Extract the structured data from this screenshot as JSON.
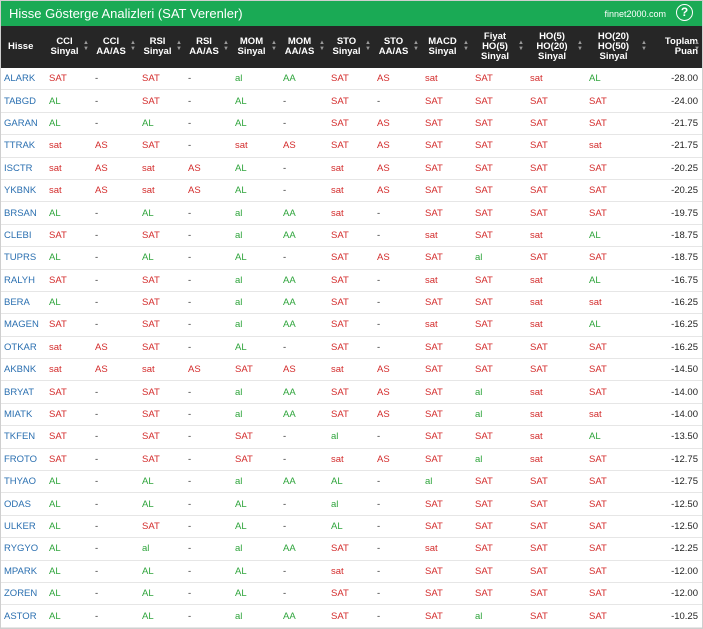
{
  "header": {
    "title": "Hisse Gösterge Analizleri (SAT Verenler)",
    "brand": "finnet2000.com",
    "help_label": "?"
  },
  "colors": {
    "header_bg": "#1aaa55",
    "table_header_bg": "#262626",
    "sat": "#d32b2b",
    "al": "#2ea43b",
    "symbol": "#2a6fb0"
  },
  "columns": [
    [
      "Hisse"
    ],
    [
      "CCI",
      "Sinyal"
    ],
    [
      "CCI",
      "AA/AS"
    ],
    [
      "RSI",
      "Sinyal"
    ],
    [
      "RSI",
      "AA/AS"
    ],
    [
      "MOM",
      "Sinyal"
    ],
    [
      "MOM",
      "AA/AS"
    ],
    [
      "STO",
      "Sinyal"
    ],
    [
      "STO",
      "AA/AS"
    ],
    [
      "MACD",
      "Sinyal"
    ],
    [
      "Fiyat",
      "HO(5)",
      "Sinyal"
    ],
    [
      "HO(5)",
      "HO(20)",
      "Sinyal"
    ],
    [
      "HO(20)",
      "HO(50)",
      "Sinyal"
    ],
    [
      "Toplam",
      "Puan"
    ]
  ],
  "rows": [
    [
      "ALARK",
      "SAT",
      "-",
      "SAT",
      "-",
      "al",
      "AA",
      "SAT",
      "AS",
      "sat",
      "SAT",
      "sat",
      "AL",
      "-28.00"
    ],
    [
      "TABGD",
      "AL",
      "-",
      "SAT",
      "-",
      "AL",
      "-",
      "SAT",
      "-",
      "SAT",
      "SAT",
      "SAT",
      "SAT",
      "-24.00"
    ],
    [
      "GARAN",
      "AL",
      "-",
      "AL",
      "-",
      "AL",
      "-",
      "SAT",
      "AS",
      "SAT",
      "SAT",
      "SAT",
      "SAT",
      "-21.75"
    ],
    [
      "TTRAK",
      "sat",
      "AS",
      "SAT",
      "-",
      "sat",
      "AS",
      "SAT",
      "AS",
      "SAT",
      "SAT",
      "SAT",
      "sat",
      "-21.75"
    ],
    [
      "ISCTR",
      "sat",
      "AS",
      "sat",
      "AS",
      "AL",
      "-",
      "sat",
      "AS",
      "SAT",
      "SAT",
      "SAT",
      "SAT",
      "-20.25"
    ],
    [
      "YKBNK",
      "sat",
      "AS",
      "sat",
      "AS",
      "AL",
      "-",
      "sat",
      "AS",
      "SAT",
      "SAT",
      "SAT",
      "SAT",
      "-20.25"
    ],
    [
      "BRSAN",
      "AL",
      "-",
      "AL",
      "-",
      "al",
      "AA",
      "sat",
      "-",
      "SAT",
      "SAT",
      "SAT",
      "SAT",
      "-19.75"
    ],
    [
      "CLEBI",
      "SAT",
      "-",
      "SAT",
      "-",
      "al",
      "AA",
      "SAT",
      "-",
      "sat",
      "SAT",
      "sat",
      "AL",
      "-18.75"
    ],
    [
      "TUPRS",
      "AL",
      "-",
      "AL",
      "-",
      "AL",
      "-",
      "SAT",
      "AS",
      "SAT",
      "al",
      "SAT",
      "SAT",
      "-18.75"
    ],
    [
      "RALYH",
      "SAT",
      "-",
      "SAT",
      "-",
      "al",
      "AA",
      "SAT",
      "-",
      "sat",
      "SAT",
      "sat",
      "AL",
      "-16.75"
    ],
    [
      "BERA",
      "AL",
      "-",
      "SAT",
      "-",
      "al",
      "AA",
      "SAT",
      "-",
      "SAT",
      "SAT",
      "sat",
      "sat",
      "-16.25"
    ],
    [
      "MAGEN",
      "SAT",
      "-",
      "SAT",
      "-",
      "al",
      "AA",
      "SAT",
      "-",
      "sat",
      "SAT",
      "sat",
      "AL",
      "-16.25"
    ],
    [
      "OTKAR",
      "sat",
      "AS",
      "SAT",
      "-",
      "AL",
      "-",
      "SAT",
      "-",
      "SAT",
      "SAT",
      "SAT",
      "SAT",
      "-16.25"
    ],
    [
      "AKBNK",
      "sat",
      "AS",
      "sat",
      "AS",
      "SAT",
      "AS",
      "sat",
      "AS",
      "SAT",
      "SAT",
      "SAT",
      "SAT",
      "-14.50"
    ],
    [
      "BRYAT",
      "SAT",
      "-",
      "SAT",
      "-",
      "al",
      "AA",
      "SAT",
      "AS",
      "SAT",
      "al",
      "sat",
      "SAT",
      "-14.00"
    ],
    [
      "MIATK",
      "SAT",
      "-",
      "SAT",
      "-",
      "al",
      "AA",
      "SAT",
      "AS",
      "SAT",
      "al",
      "sat",
      "sat",
      "-14.00"
    ],
    [
      "TKFEN",
      "SAT",
      "-",
      "SAT",
      "-",
      "SAT",
      "-",
      "al",
      "-",
      "SAT",
      "SAT",
      "sat",
      "AL",
      "-13.50"
    ],
    [
      "FROTO",
      "SAT",
      "-",
      "SAT",
      "-",
      "SAT",
      "-",
      "sat",
      "AS",
      "SAT",
      "al",
      "sat",
      "SAT",
      "-12.75"
    ],
    [
      "THYAO",
      "AL",
      "-",
      "AL",
      "-",
      "al",
      "AA",
      "AL",
      "-",
      "al",
      "SAT",
      "SAT",
      "SAT",
      "-12.75"
    ],
    [
      "ODAS",
      "AL",
      "-",
      "AL",
      "-",
      "AL",
      "-",
      "al",
      "-",
      "SAT",
      "SAT",
      "SAT",
      "SAT",
      "-12.50"
    ],
    [
      "ULKER",
      "AL",
      "-",
      "SAT",
      "-",
      "AL",
      "-",
      "AL",
      "-",
      "SAT",
      "SAT",
      "SAT",
      "SAT",
      "-12.50"
    ],
    [
      "RYGYO",
      "AL",
      "-",
      "al",
      "-",
      "al",
      "AA",
      "SAT",
      "-",
      "sat",
      "SAT",
      "SAT",
      "SAT",
      "-12.25"
    ],
    [
      "MPARK",
      "AL",
      "-",
      "AL",
      "-",
      "AL",
      "-",
      "sat",
      "-",
      "SAT",
      "SAT",
      "SAT",
      "SAT",
      "-12.00"
    ],
    [
      "ZOREN",
      "AL",
      "-",
      "AL",
      "-",
      "AL",
      "-",
      "SAT",
      "-",
      "SAT",
      "SAT",
      "SAT",
      "SAT",
      "-12.00"
    ],
    [
      "ASTOR",
      "AL",
      "-",
      "AL",
      "-",
      "al",
      "AA",
      "SAT",
      "-",
      "SAT",
      "al",
      "SAT",
      "SAT",
      "-10.25"
    ]
  ]
}
